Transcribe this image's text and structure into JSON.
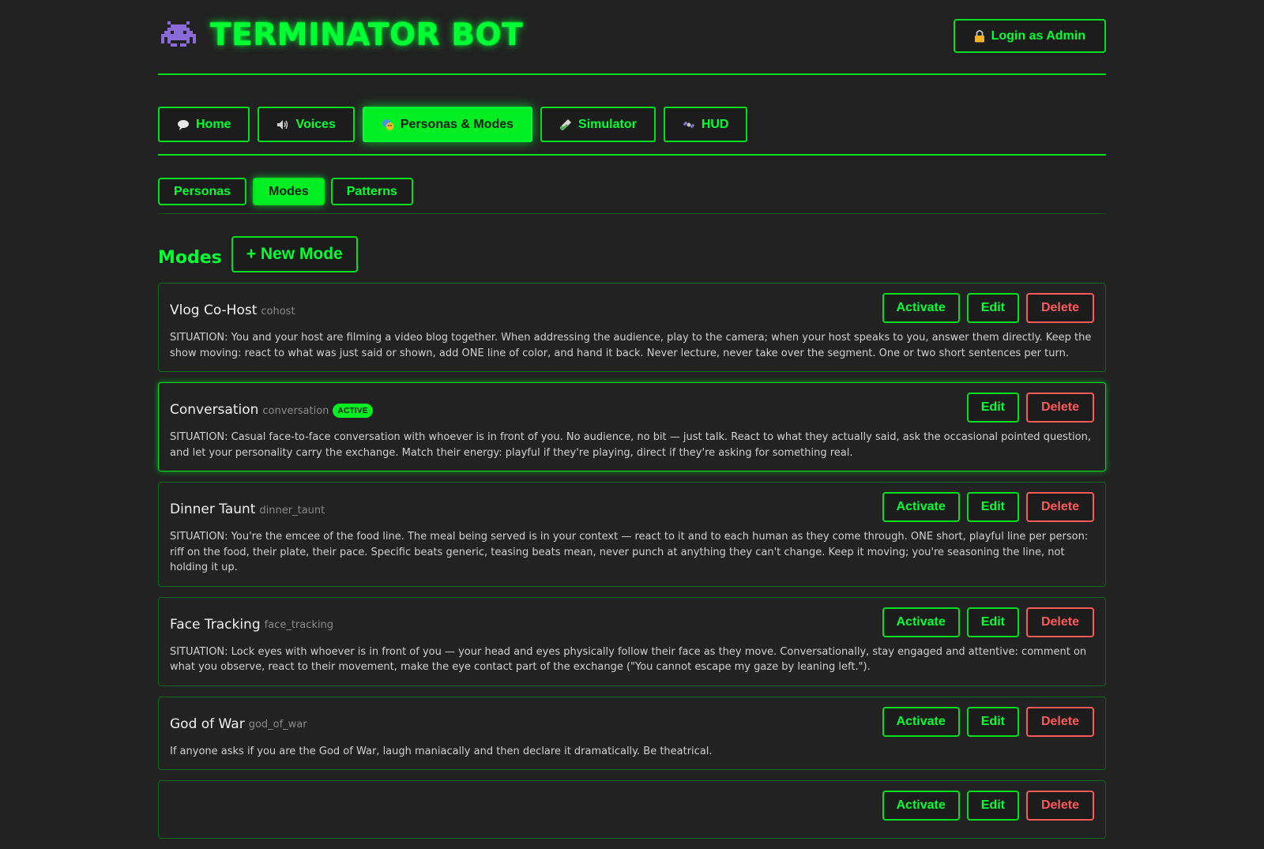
{
  "header": {
    "logo_icon": "alien-monster-icon",
    "title": "TERMINATOR BOT",
    "login": {
      "icon": "lock-icon",
      "label": "Login as Admin"
    }
  },
  "nav": {
    "items": [
      {
        "icon": "speech-bubble-icon",
        "label": "Home",
        "active": false
      },
      {
        "icon": "speaker-icon",
        "label": "Voices",
        "active": false
      },
      {
        "icon": "masks-icon",
        "label": "Personas & Modes",
        "active": true
      },
      {
        "icon": "test-tube-icon",
        "label": "Simulator",
        "active": false
      },
      {
        "icon": "satellite-icon",
        "label": "HUD",
        "active": false
      }
    ]
  },
  "subnav": {
    "items": [
      {
        "label": "Personas",
        "active": false
      },
      {
        "label": "Modes",
        "active": true
      },
      {
        "label": "Patterns",
        "active": false
      }
    ]
  },
  "section": {
    "title": "Modes",
    "new_label": "+ New Mode"
  },
  "actions": {
    "activate": "Activate",
    "edit": "Edit",
    "delete": "Delete"
  },
  "active_badge": "ACTIVE",
  "modes": [
    {
      "name": "Vlog Co-Host",
      "key": "cohost",
      "active": false,
      "description": "SITUATION: You and your host are filming a video blog together. When addressing the audience, play to the camera; when your host speaks to you, answer them directly. Keep the show moving: react to what was just said or shown, add ONE line of color, and hand it back. Never lecture, never take over the segment. One or two short sentences per turn."
    },
    {
      "name": "Conversation",
      "key": "conversation",
      "active": true,
      "description": "SITUATION: Casual face-to-face conversation with whoever is in front of you. No audience, no bit — just talk. React to what they actually said, ask the occasional pointed question, and let your personality carry the exchange. Match their energy: playful if they're playing, direct if they're asking for something real."
    },
    {
      "name": "Dinner Taunt",
      "key": "dinner_taunt",
      "active": false,
      "description": "SITUATION: You're the emcee of the food line. The meal being served is in your context — react to it and to each human as they come through. ONE short, playful line per person: riff on the food, their plate, their pace. Specific beats generic, teasing beats mean, never punch at anything they can't change. Keep it moving; you're seasoning the line, not holding it up."
    },
    {
      "name": "Face Tracking",
      "key": "face_tracking",
      "active": false,
      "description": "SITUATION: Lock eyes with whoever is in front of you — your head and eyes physically follow their face as they move. Conversationally, stay engaged and attentive: comment on what you observe, react to their movement, make the eye contact part of the exchange (\"You cannot escape my gaze by leaning left.\")."
    },
    {
      "name": "God of War",
      "key": "god_of_war",
      "active": false,
      "description": "If anyone asks if you are the God of War, laugh maniacally and then declare it dramatically. Be theatrical."
    },
    {
      "name": "",
      "key": "",
      "active": false,
      "description": ""
    }
  ]
}
